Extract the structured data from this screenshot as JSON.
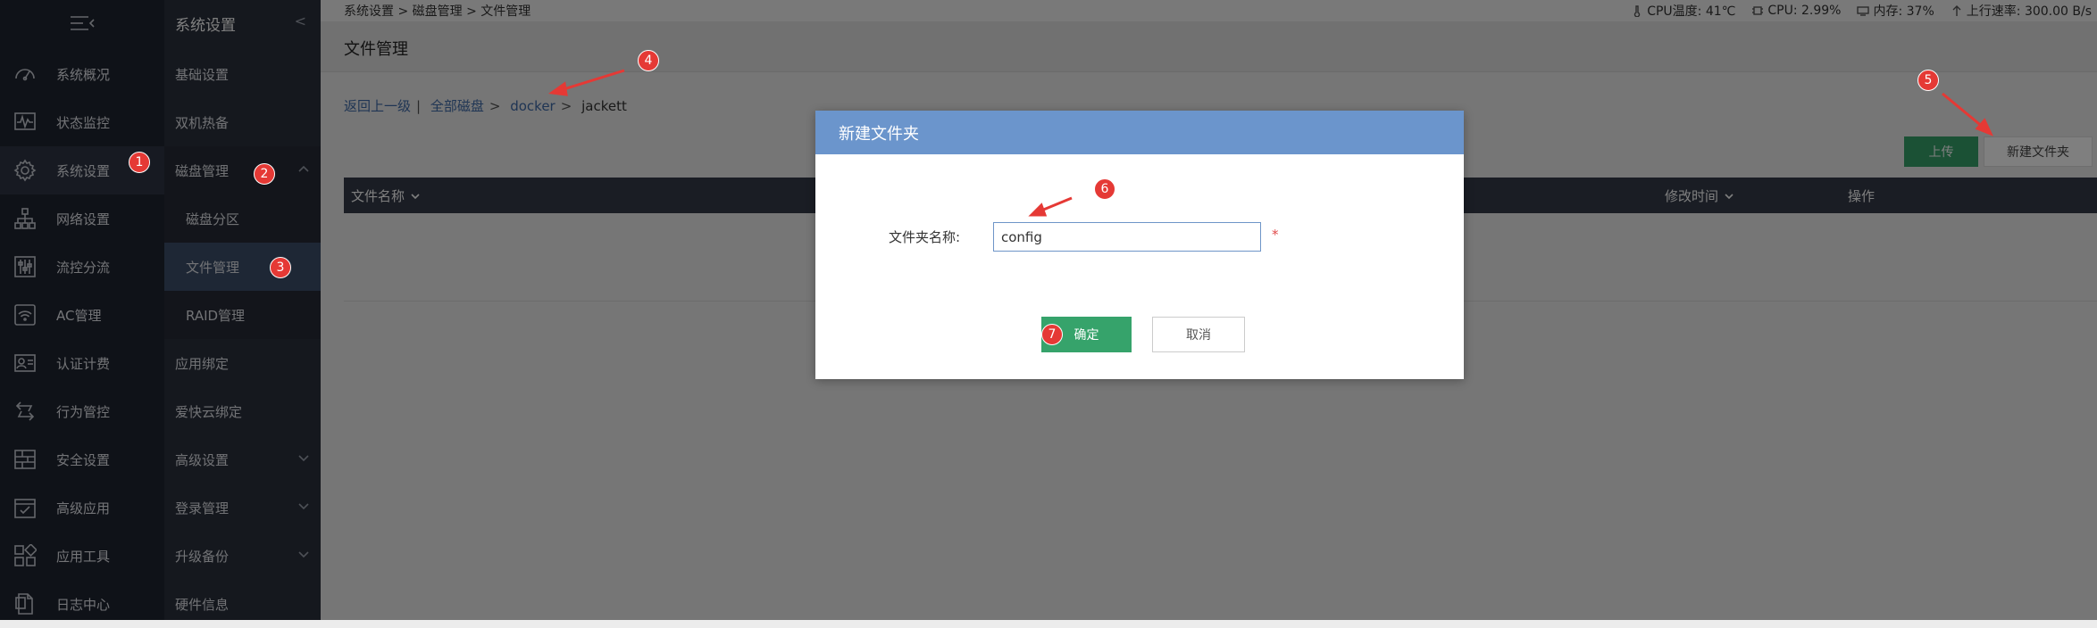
{
  "topbar": {
    "breadcrumb": "系统设置 > 磁盘管理 > 文件管理",
    "cpu_temp": "CPU温度: 41℃",
    "cpu_usage": "CPU: 2.99%",
    "memory": "内存: 37%",
    "upload_rate": "上行速率: 300.00 B/s"
  },
  "nav1": {
    "items": [
      {
        "label": "系统概况",
        "icon": "dashboard-icon"
      },
      {
        "label": "状态监控",
        "icon": "monitor-icon"
      },
      {
        "label": "系统设置",
        "icon": "gear-icon"
      },
      {
        "label": "网络设置",
        "icon": "network-icon"
      },
      {
        "label": "流控分流",
        "icon": "sliders-icon"
      },
      {
        "label": "AC管理",
        "icon": "wifi-icon"
      },
      {
        "label": "认证计费",
        "icon": "id-card-icon"
      },
      {
        "label": "行为管控",
        "icon": "arrows-icon"
      },
      {
        "label": "安全设置",
        "icon": "firewall-icon"
      },
      {
        "label": "高级应用",
        "icon": "calendar-check-icon"
      },
      {
        "label": "应用工具",
        "icon": "apps-icon"
      },
      {
        "label": "日志中心",
        "icon": "document-icon"
      }
    ]
  },
  "nav2": {
    "title": "系统设置",
    "items": [
      {
        "label": "基础设置"
      },
      {
        "label": "双机热备"
      },
      {
        "label": "磁盘管理"
      },
      {
        "label": "磁盘分区"
      },
      {
        "label": "文件管理"
      },
      {
        "label": "RAID管理"
      },
      {
        "label": "应用绑定"
      },
      {
        "label": "爱快云绑定"
      },
      {
        "label": "高级设置"
      },
      {
        "label": "登录管理"
      },
      {
        "label": "升级备份"
      },
      {
        "label": "硬件信息"
      }
    ]
  },
  "page": {
    "title": "文件管理",
    "back": "返回上一级",
    "all_disks": "全部磁盘",
    "path1": "docker",
    "path2": "jackett",
    "upload_btn": "上传",
    "newdir_btn": "新建文件夹",
    "col_name": "文件名称",
    "col_modified": "修改时间",
    "col_ops": "操作"
  },
  "dialog": {
    "title": "新建文件夹",
    "label": "文件夹名称:",
    "value": "config",
    "required": "*",
    "ok": "确定",
    "cancel": "取消"
  },
  "annotations": [
    "1",
    "2",
    "3",
    "4",
    "5",
    "6",
    "7"
  ],
  "colors": {
    "nav_bg": "#1f2430",
    "dialog_header": "#6b95cc",
    "primary_green": "#36a36b",
    "badge_red": "#e53935"
  }
}
